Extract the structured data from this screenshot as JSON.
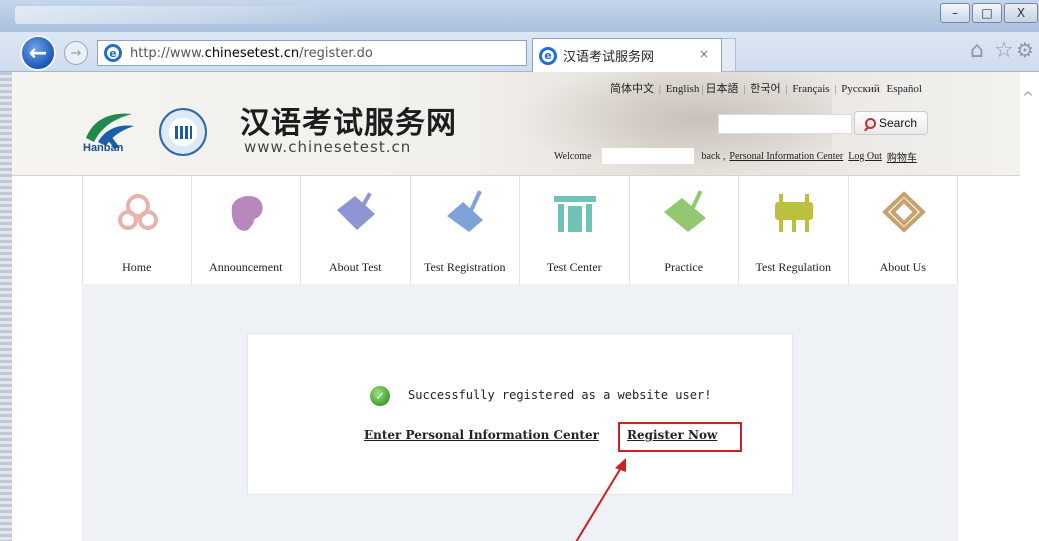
{
  "browser": {
    "url_prefix": "http://www.",
    "url_domain": "chinesetest.cn",
    "url_path": "/register.do",
    "tab_title": "汉语考试服务网",
    "tab_close": "×",
    "search_glyph": "⚲",
    "dropdown_glyph": "▾",
    "refresh_glyph": "↻",
    "back_glyph": "←",
    "forward_glyph": "→",
    "window_min": "–",
    "window_max": "□",
    "window_close": "X",
    "toolbar_icons": [
      "home-icon",
      "star-icon",
      "gear-icon"
    ]
  },
  "header": {
    "site_name_cn": "汉语考试服务网",
    "site_url": "www.chinesetest.cn",
    "logo_text": "Hanban",
    "languages": [
      "简体中文",
      "English",
      "日本語",
      "한국어",
      "Français",
      "Русский",
      "Español"
    ],
    "search_button": "Search",
    "welcome": "Welcome",
    "back_text": "back ,",
    "personal_center_link": "Personal Information Center",
    "logout_link": "Log Out",
    "cart_link": "购物车"
  },
  "nav": {
    "items": [
      {
        "label": "Home",
        "icon": "home-ornament-icon",
        "color": "#e8b3ad"
      },
      {
        "label": "Announcement",
        "icon": "swirl-icon",
        "color": "#b887bd"
      },
      {
        "label": "About Test",
        "icon": "scroll-icon",
        "color": "#8d95d4"
      },
      {
        "label": "Test Registration",
        "icon": "brush-icon",
        "color": "#7fa3d6"
      },
      {
        "label": "Test Center",
        "icon": "gate-icon",
        "color": "#6fc2b6"
      },
      {
        "label": "Practice",
        "icon": "book-icon",
        "color": "#93c770"
      },
      {
        "label": "Test Regulation",
        "icon": "bronze-vessel-icon",
        "color": "#bcc03f"
      },
      {
        "label": "About Us",
        "icon": "knot-icon",
        "color": "#c6a16b"
      }
    ]
  },
  "main": {
    "success_message": "Successfully registered as a website user!",
    "enter_link": "Enter Personal Information Center",
    "register_link": "Register Now",
    "highlight_color": "#d11f1f"
  }
}
